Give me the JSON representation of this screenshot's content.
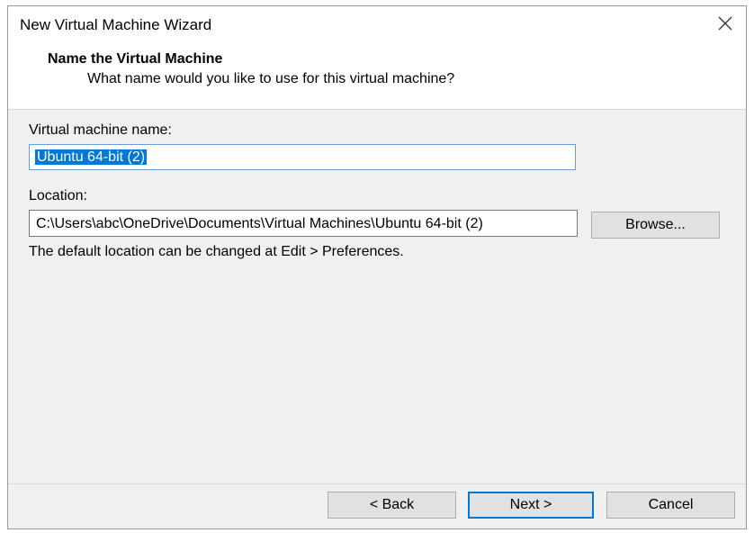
{
  "window": {
    "title": "New Virtual Machine Wizard",
    "close_icon": "close-icon"
  },
  "header": {
    "title": "Name the Virtual Machine",
    "subtitle": "What name would you like to use for this virtual machine?"
  },
  "form": {
    "vm_name_label": "Virtual machine name:",
    "vm_name_value": "Ubuntu 64-bit (2)",
    "location_label": "Location:",
    "location_value": "C:\\Users\\abc\\OneDrive\\Documents\\Virtual Machines\\Ubuntu 64-bit (2)",
    "browse_label": "Browse...",
    "hint": "The default location can be changed at Edit > Preferences."
  },
  "footer": {
    "back_label": "< Back",
    "next_label": "Next >",
    "cancel_label": "Cancel"
  },
  "colors": {
    "selection": "#0078d7",
    "focus_border": "#6a9ad8",
    "button_bg": "#e1e1e1"
  }
}
